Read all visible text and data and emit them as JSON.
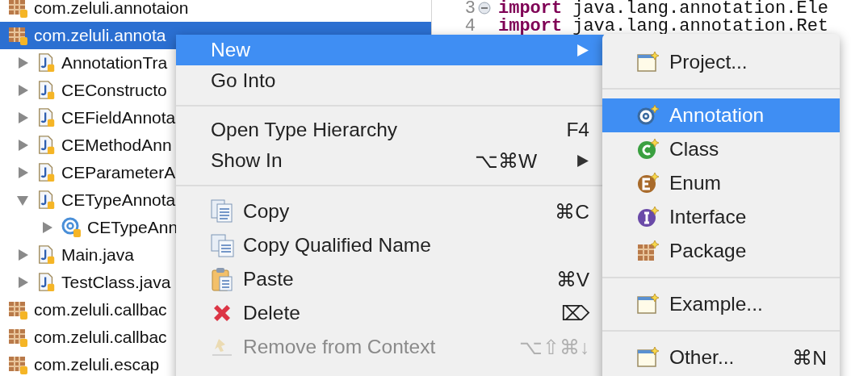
{
  "tree": [
    {
      "kind": "package",
      "label": "com.zeluli.annotaion",
      "selected": false
    },
    {
      "kind": "package",
      "label": "com.zeluli.annota",
      "selected": true,
      "children": [
        {
          "kind": "file",
          "label": "AnnotationTra",
          "selected": false,
          "expanded": false
        },
        {
          "kind": "file",
          "label": "CEConstructo",
          "selected": false,
          "expanded": false
        },
        {
          "kind": "file",
          "label": "CEFieldAnnota",
          "selected": false,
          "expanded": false
        },
        {
          "kind": "file",
          "label": "CEMethodAnn",
          "selected": false,
          "expanded": false
        },
        {
          "kind": "file",
          "label": "CEParameterA",
          "selected": false,
          "expanded": false
        },
        {
          "kind": "file",
          "label": "CETypeAnnota",
          "selected": false,
          "expanded": true,
          "children": [
            {
              "kind": "annotation",
              "label": "CETypeAnn",
              "selected": false,
              "expanded": false
            }
          ]
        },
        {
          "kind": "file",
          "label": "Main.java",
          "selected": false,
          "expanded": false
        },
        {
          "kind": "file",
          "label": "TestClass.java",
          "selected": false,
          "expanded": false
        }
      ]
    },
    {
      "kind": "package",
      "label": "com.zeluli.callbac",
      "selected": false
    },
    {
      "kind": "package",
      "label": "com.zeluli.callbac",
      "selected": false
    },
    {
      "kind": "package",
      "label": "com.zeluli.escap",
      "selected": false
    }
  ],
  "editor": {
    "lines": [
      {
        "kind": "code",
        "number": "3",
        "expanded": true,
        "keyword": "import",
        "text": "java.lang.annotation.Ele"
      },
      {
        "kind": "code",
        "number": "4",
        "keyword": "import",
        "text": "java.lang.annotation.Ret"
      }
    ]
  },
  "context_menu": {
    "groups": [
      [
        {
          "kind": "plain",
          "label": "New",
          "selected": true,
          "disabled": false,
          "submenu": true
        },
        {
          "kind": "plain",
          "label": "Go Into",
          "selected": false,
          "disabled": false,
          "submenu": false
        }
      ],
      [
        {
          "kind": "plain",
          "label": "Open Type Hierarchy",
          "shortcut": "F4",
          "selected": false,
          "disabled": false,
          "submenu": false
        },
        {
          "kind": "plain",
          "label": "Show In",
          "shortcut": "⌥⌘W",
          "selected": false,
          "disabled": false,
          "submenu": true
        }
      ],
      [
        {
          "kind": "copy",
          "label": "Copy",
          "shortcut": "⌘C",
          "selected": false,
          "disabled": false,
          "submenu": false
        },
        {
          "kind": "copyname",
          "label": "Copy Qualified Name",
          "selected": false,
          "disabled": false,
          "submenu": false
        },
        {
          "kind": "paste",
          "label": "Paste",
          "shortcut": "⌘V",
          "selected": false,
          "disabled": false,
          "submenu": false
        },
        {
          "kind": "delete",
          "label": "Delete",
          "shortcut": "⌦",
          "selected": false,
          "disabled": false,
          "submenu": false
        },
        {
          "kind": "remove",
          "label": "Remove from Context",
          "shortcut": "⌥⇧⌘↓",
          "selected": false,
          "disabled": true,
          "submenu": false
        }
      ]
    ]
  },
  "submenu": {
    "groups": [
      [
        {
          "kind": "wizard",
          "label": "Project...",
          "selected": false
        }
      ],
      [
        {
          "kind": "annotation",
          "label": "Annotation",
          "selected": true
        },
        {
          "kind": "class",
          "label": "Class",
          "selected": false
        },
        {
          "kind": "enum",
          "label": "Enum",
          "selected": false
        },
        {
          "kind": "interface",
          "label": "Interface",
          "selected": false
        },
        {
          "kind": "package",
          "label": "Package",
          "selected": false
        }
      ],
      [
        {
          "kind": "wizard",
          "label": "Example...",
          "selected": false
        }
      ],
      [
        {
          "kind": "wizard",
          "label": "Other...",
          "shortcut": "⌘N",
          "selected": false
        }
      ]
    ]
  }
}
